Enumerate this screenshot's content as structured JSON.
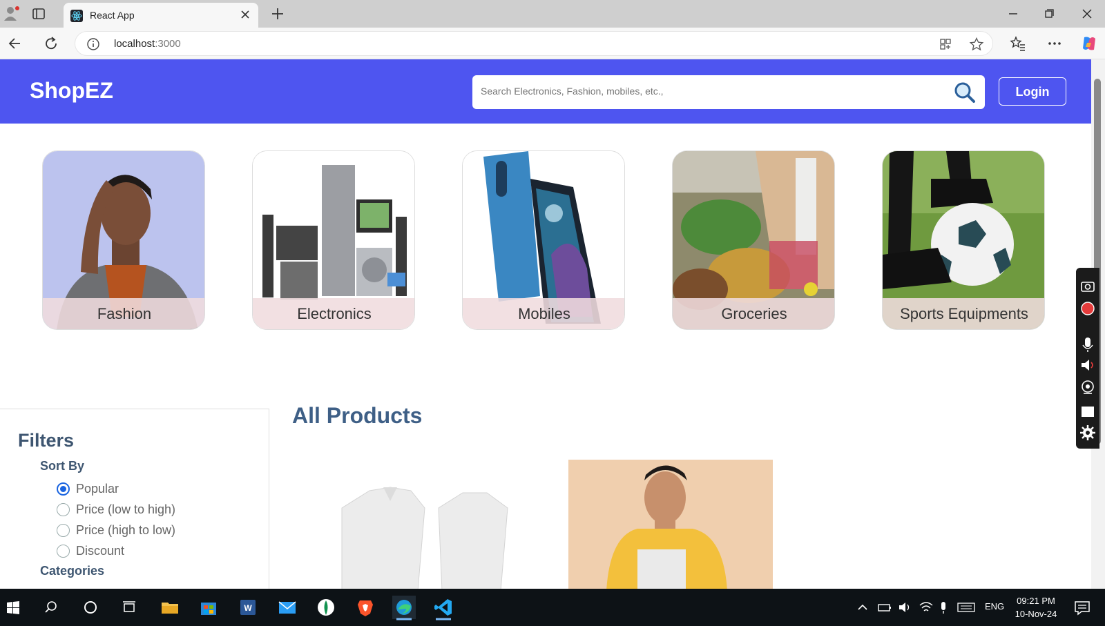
{
  "browser": {
    "tab_title": "React App",
    "url_host": "localhost",
    "url_port": ":3000"
  },
  "header": {
    "logo": "ShopEZ",
    "search_placeholder": "Search Electronics, Fashion, mobiles, etc.,",
    "login_label": "Login"
  },
  "categories": [
    {
      "label": "Fashion",
      "icon": "fashion-photo"
    },
    {
      "label": "Electronics",
      "icon": "electronics-photo"
    },
    {
      "label": "Mobiles",
      "icon": "mobiles-photo"
    },
    {
      "label": "Groceries",
      "icon": "groceries-photo"
    },
    {
      "label": "Sports Equipments",
      "icon": "sports-photo"
    }
  ],
  "filters": {
    "title": "Filters",
    "sort_by_label": "Sort By",
    "sort_options": [
      "Popular",
      "Price (low to high)",
      "Price (high to low)",
      "Discount"
    ],
    "selected_sort": "Popular",
    "categories_label": "Categories"
  },
  "products": {
    "title": "All Products"
  },
  "taskbar": {
    "lang": "ENG",
    "time": "09:21 PM",
    "date": "10-Nov-24"
  },
  "colors": {
    "header_bg": "#4e55f0",
    "heading": "#3e5671",
    "radio_selected": "#1a64e0"
  }
}
